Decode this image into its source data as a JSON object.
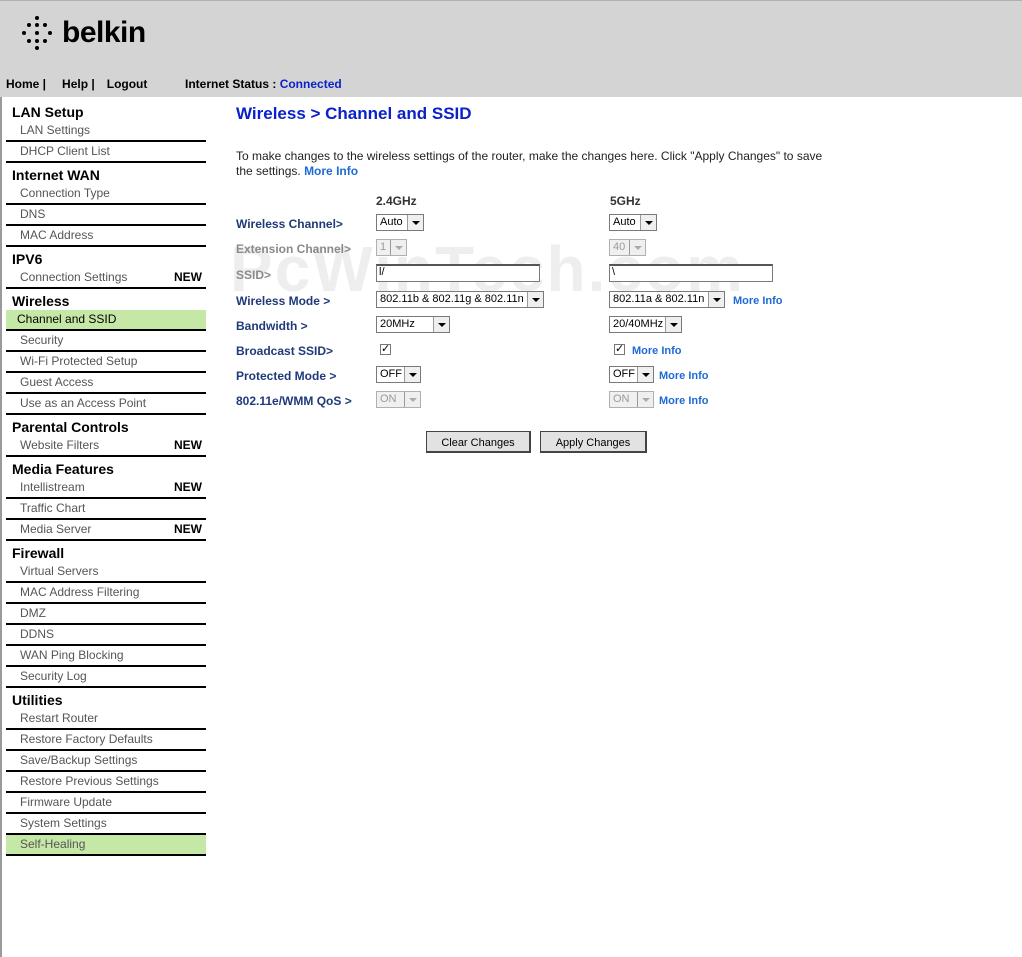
{
  "brand": {
    "name": "belkin"
  },
  "topnav": {
    "home": "Home |",
    "help": "Help |",
    "logout": "Logout"
  },
  "status": {
    "label": "Internet Status :",
    "value": "Connected"
  },
  "sidebar": {
    "sections": [
      {
        "title": "LAN Setup",
        "items": [
          {
            "label": "LAN Settings"
          },
          {
            "label": "DHCP Client List"
          }
        ]
      },
      {
        "title": "Internet WAN",
        "items": [
          {
            "label": "Connection Type"
          },
          {
            "label": "DNS"
          },
          {
            "label": "MAC Address"
          }
        ]
      },
      {
        "title": "IPV6",
        "items": [
          {
            "label": "Connection Settings",
            "badge": "NEW"
          }
        ]
      },
      {
        "title": "Wireless",
        "items": [
          {
            "label": "Channel and SSID",
            "active": true
          },
          {
            "label": "Security"
          },
          {
            "label": "Wi-Fi Protected Setup"
          },
          {
            "label": "Guest Access"
          },
          {
            "label": "Use as an Access Point"
          }
        ]
      },
      {
        "title": "Parental Controls",
        "items": [
          {
            "label": "Website Filters",
            "badge": "NEW"
          }
        ]
      },
      {
        "title": "Media Features",
        "items": [
          {
            "label": "Intellistream",
            "badge": "NEW"
          },
          {
            "label": "Traffic Chart"
          },
          {
            "label": "Media Server",
            "badge": "NEW"
          }
        ]
      },
      {
        "title": "Firewall",
        "items": [
          {
            "label": "Virtual Servers"
          },
          {
            "label": "MAC Address Filtering"
          },
          {
            "label": "DMZ"
          },
          {
            "label": "DDNS"
          },
          {
            "label": "WAN Ping Blocking"
          },
          {
            "label": "Security Log"
          }
        ]
      },
      {
        "title": "Utilities",
        "items": [
          {
            "label": "Restart Router"
          },
          {
            "label": "Restore Factory Defaults"
          },
          {
            "label": "Save/Backup Settings"
          },
          {
            "label": "Restore Previous Settings"
          },
          {
            "label": "Firmware Update"
          },
          {
            "label": "System Settings"
          },
          {
            "label": "Self-Healing",
            "highlight": true
          }
        ]
      }
    ]
  },
  "main": {
    "title": "Wireless > Channel and SSID",
    "intro": "To make changes to the wireless settings of the router, make the changes here. Click \"Apply Changes\" to save the settings.",
    "more_info": "More Info",
    "col_24": "2.4GHz",
    "col_5": "5GHz",
    "labels": {
      "channel": "Wireless Channel>",
      "extension": "Extension Channel>",
      "ssid": "SSID>",
      "mode": "Wireless Mode >",
      "bandwidth": "Bandwidth >",
      "broadcast": "Broadcast SSID>",
      "protected": "Protected Mode >",
      "qos": "802.11e/WMM QoS >"
    },
    "band24": {
      "channel": "Auto",
      "extension": "1",
      "ssid": "l/",
      "mode": "802.11b & 802.11g & 802.11n",
      "bandwidth": "20MHz",
      "broadcast": "✓",
      "protected": "OFF",
      "qos": "ON"
    },
    "band5": {
      "channel": "Auto",
      "extension": "40",
      "ssid": "\\",
      "mode": "802.11a & 802.11n",
      "bandwidth": "20/40MHz",
      "broadcast": "✓",
      "protected": "OFF",
      "qos": "ON"
    },
    "buttons": {
      "clear": "Clear Changes",
      "apply": "Apply Changes"
    }
  },
  "watermark": "PcWinTech.com"
}
